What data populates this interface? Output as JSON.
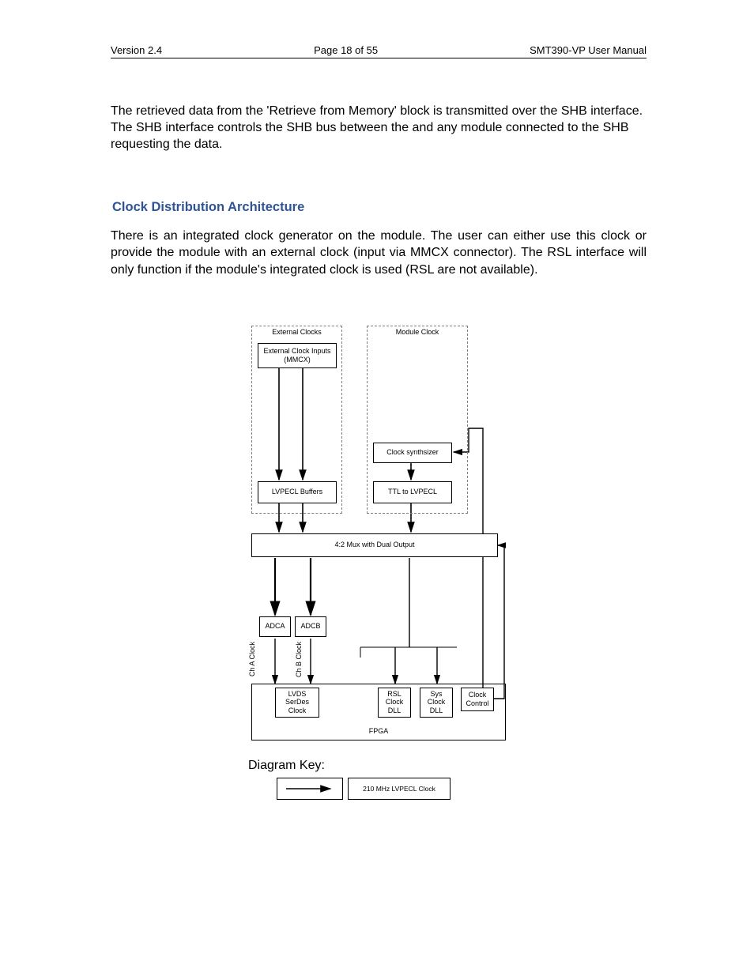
{
  "header": {
    "left": "Version 2.4",
    "center": "Page 18 of 55",
    "right": "SMT390-VP User Manual"
  },
  "para1_a": "The retrieved data from the 'Retrieve from Memory' block is transmitted over the SHB interface. The SHB interface controls the SHB bus between the ",
  "para1_b": " and any module connected to the SHB requesting the data.",
  "section_title": "Clock Distribution Architecture",
  "para2": "There is an integrated clock generator on the module. The user can either use this clock or provide the module with an external clock (input via MMCX connector). The RSL interface will only function if the module's integrated clock is used (RSL are not available).",
  "diagram": {
    "group_ext": "External Clocks",
    "group_mod": "Module Clock",
    "ext_inputs": "External Clock Inputs (MMCX)",
    "clk_synth": "Clock synthsizer",
    "lvpecl_buf": "LVPECL Buffers",
    "ttl_lvpecl": "TTL to LVPECL",
    "mux": "4:2 Mux with Dual Output",
    "adca": "ADCA",
    "adcb": "ADCB",
    "cha": "Ch A Clock",
    "chb": "Ch B Clock",
    "lvds": "LVDS SerDes Clock",
    "rsl": "RSL Clock DLL",
    "sys": "Sys Clock DLL",
    "ctrl": "Clock Control",
    "fpga": "FPGA"
  },
  "key": {
    "title": "Diagram Key:",
    "item1": "210 MHz LVPECL Clock"
  }
}
